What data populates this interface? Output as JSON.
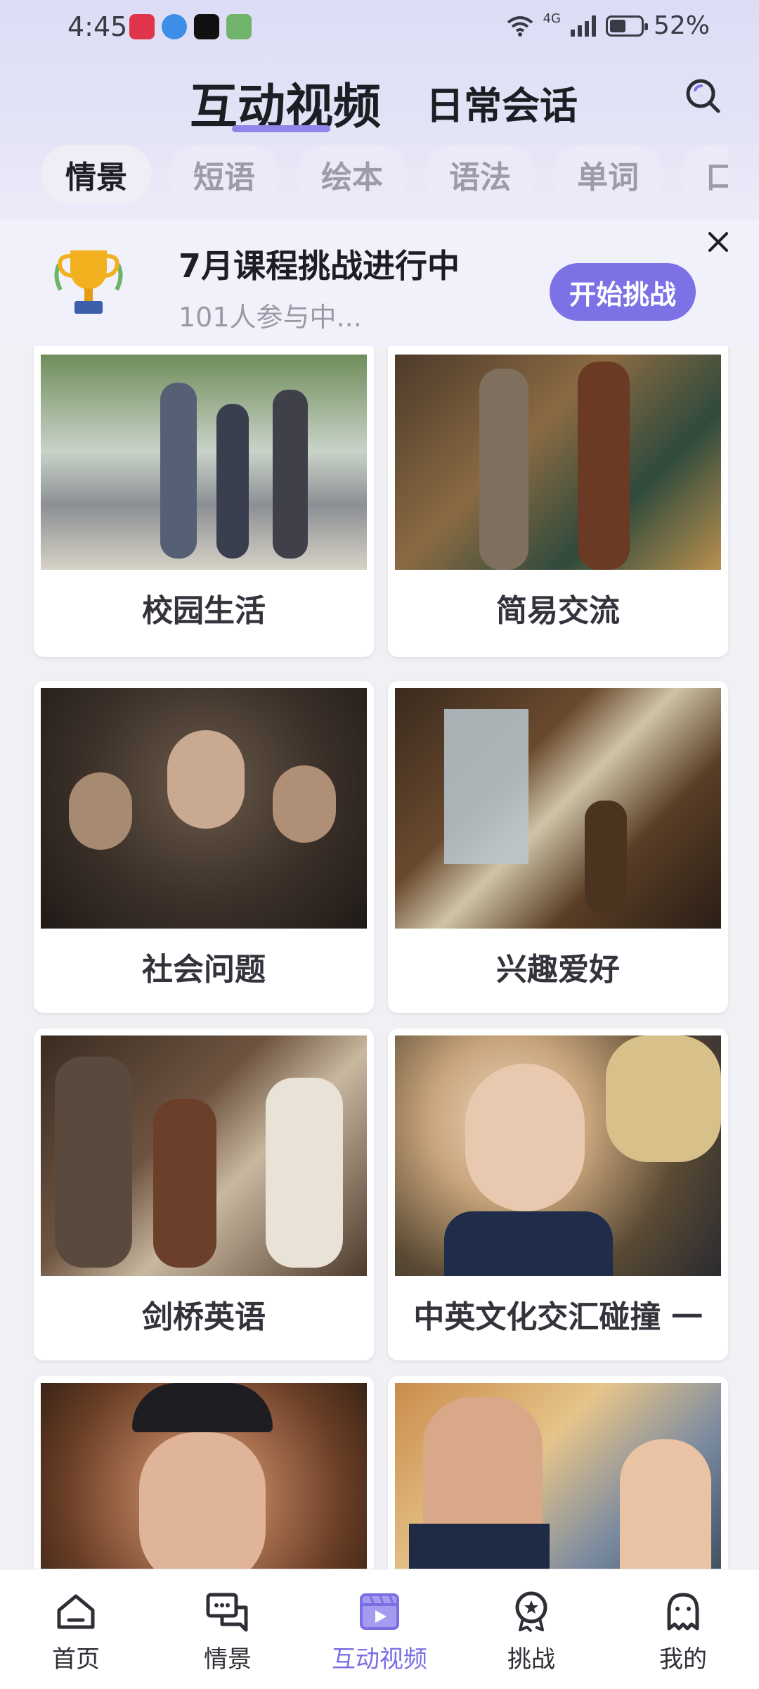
{
  "status_bar": {
    "time": "4:45",
    "network": "4G",
    "battery": "52%",
    "battery_level": 0.52,
    "notification_apps": [
      "reader-app-icon",
      "browser-app-icon",
      "tiktok-app-icon",
      "game-app-icon"
    ]
  },
  "header": {
    "tabs": [
      {
        "label": "互动视频",
        "active": true
      },
      {
        "label": "日常会话",
        "active": false
      }
    ],
    "search_icon": "search-icon"
  },
  "categories": [
    {
      "label": "情景",
      "active": true
    },
    {
      "label": "短语",
      "active": false
    },
    {
      "label": "绘本",
      "active": false
    },
    {
      "label": "语法",
      "active": false
    },
    {
      "label": "单词",
      "active": false
    },
    {
      "label": "口",
      "active": false
    }
  ],
  "challenge_banner": {
    "title": "7月课程挑战进行中",
    "subtitle": "101人参与中...",
    "button": "开始挑战",
    "icon": "trophy-icon",
    "close_icon": "close-icon"
  },
  "topics": [
    {
      "title": "校园生活",
      "image": "students-on-campus"
    },
    {
      "title": "简易交流",
      "image": "couple-at-shop"
    },
    {
      "title": "社会问题",
      "image": "crowd-of-people"
    },
    {
      "title": "兴趣爱好",
      "image": "man-at-desk-study"
    },
    {
      "title": "剑桥英语",
      "image": "girls-reading-books"
    },
    {
      "title": "中英文化交汇碰撞 一",
      "image": "woman-in-qipao"
    },
    {
      "title": "",
      "image": "smiling-bearded-man"
    },
    {
      "title": "",
      "image": "man-and-woman-outdoors"
    }
  ],
  "bottom_nav": [
    {
      "label": "首页",
      "icon": "home-icon",
      "active": false
    },
    {
      "label": "情景",
      "icon": "chat-bubbles-icon",
      "active": false
    },
    {
      "label": "互动视频",
      "icon": "video-icon",
      "active": true
    },
    {
      "label": "挑战",
      "icon": "medal-icon",
      "active": false
    },
    {
      "label": "我的",
      "icon": "profile-icon",
      "active": false
    }
  ],
  "colors": {
    "accent": "#7d71e6",
    "header_bg": "#dcdcf6",
    "page_bg": "#f1f1f5"
  }
}
